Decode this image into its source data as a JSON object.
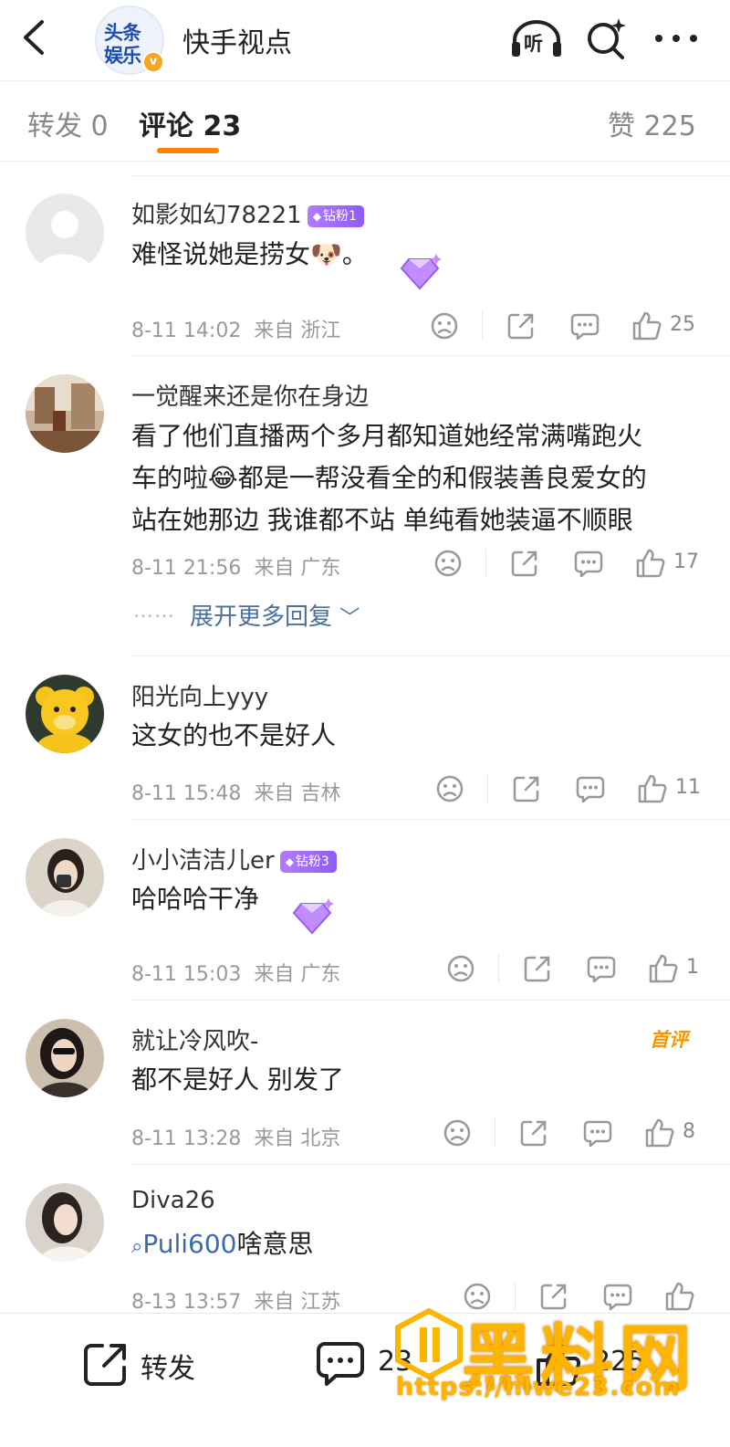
{
  "header": {
    "title": "快手视点",
    "logo_line1": "头条",
    "logo_line2": "娱乐",
    "verified_mark": "v",
    "listen_label": "听",
    "icons": [
      "back-arrow-icon",
      "listen-headphones-icon",
      "search-sparkle-icon",
      "more-dots-icon"
    ]
  },
  "tabs": {
    "repost": "转发 0",
    "comment": "评论 23",
    "like": "赞 225",
    "active": "comment",
    "accent_color": "#ff8200"
  },
  "comments": [
    {
      "username": "如影如幻78221",
      "fan_badge": "钻粉1",
      "text": "难怪说她是捞女",
      "emoji": "🐶",
      "text_suffix": "。",
      "time": "8-11 14:02",
      "location": "来自 浙江",
      "likes": "25"
    },
    {
      "username": "一觉醒来还是你在身边",
      "text_line1": "看了他们直播两个多月都知道她经常满嘴跑火",
      "text_line2_pre": "车的啦",
      "emoji": "😂",
      "text_line2_post": "都是一帮没看全的和假装善良爱女的",
      "text_line3": "站在她那边 我谁都不站 单纯看她装逼不顺眼",
      "time": "8-11 21:56",
      "location": "来自 广东",
      "likes": "17",
      "dots": "……",
      "expand_label": "展开更多回复",
      "expand_chevron": "﹀"
    },
    {
      "username": "阳光向上yyy",
      "text": "这女的也不是好人",
      "time": "8-11 15:48",
      "location": "来自 吉林",
      "likes": "11"
    },
    {
      "username": "小小洁洁儿er",
      "fan_badge": "钻粉3",
      "text": "哈哈哈干净",
      "time": "8-11 15:03",
      "location": "来自 广东",
      "likes": "1"
    },
    {
      "username": "就让冷风吹-",
      "badge": "首评",
      "text": "都不是好人 别发了",
      "time": "8-11 13:28",
      "location": "来自 北京",
      "likes": "8"
    },
    {
      "username": "Diva26",
      "mention": "Puli600",
      "text": "啥意思",
      "time": "8-13 13:57",
      "location": "来自 江苏"
    }
  ],
  "bottom_bar": {
    "repost_label": "转发",
    "comment_count": "23",
    "like_count": "225"
  },
  "watermark": {
    "brand": "黑料网",
    "url": "https://hlwe23.com",
    "color": "#ffb400"
  }
}
